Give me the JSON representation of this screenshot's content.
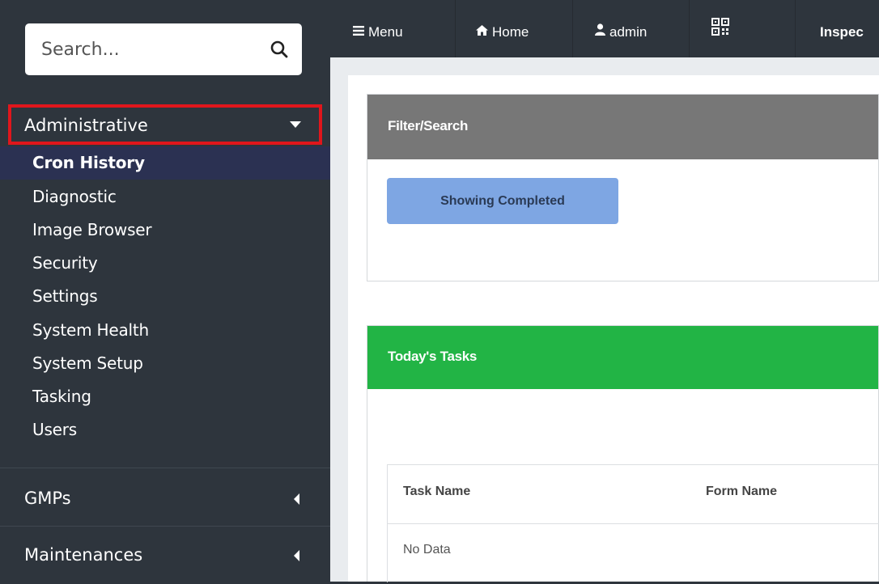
{
  "search": {
    "placeholder": "Search..."
  },
  "sidebar": {
    "administrative": {
      "label": "Administrative",
      "items": [
        {
          "label": "Cron History",
          "active": true
        },
        {
          "label": "Diagnostic"
        },
        {
          "label": "Image Browser"
        },
        {
          "label": "Security"
        },
        {
          "label": "Settings"
        },
        {
          "label": "System Health"
        },
        {
          "label": "System Setup"
        },
        {
          "label": "Tasking"
        },
        {
          "label": "Users"
        }
      ]
    },
    "sections": [
      {
        "label": "GMPs"
      },
      {
        "label": "Maintenances"
      }
    ]
  },
  "topnav": {
    "menu": "Menu",
    "home": "Home",
    "user": "admin",
    "inspect": "Inspec"
  },
  "filter_card": {
    "title": "Filter/Search",
    "button": "Showing Completed"
  },
  "tasks_card": {
    "title": "Today's Tasks",
    "columns": [
      "Task Name",
      "Form Name"
    ],
    "empty": "No Data"
  },
  "colors": {
    "sidebar_bg": "#2e353d",
    "active_item_bg": "#2b3152",
    "highlight_border": "#e0161c",
    "filter_header": "#777777",
    "tasks_header": "#22b445",
    "button_bg": "#7ea6e3"
  },
  "icons": [
    "search-icon",
    "menu-icon",
    "home-icon",
    "user-icon",
    "qr-code-icon",
    "caret-down-icon",
    "caret-left-icon"
  ]
}
